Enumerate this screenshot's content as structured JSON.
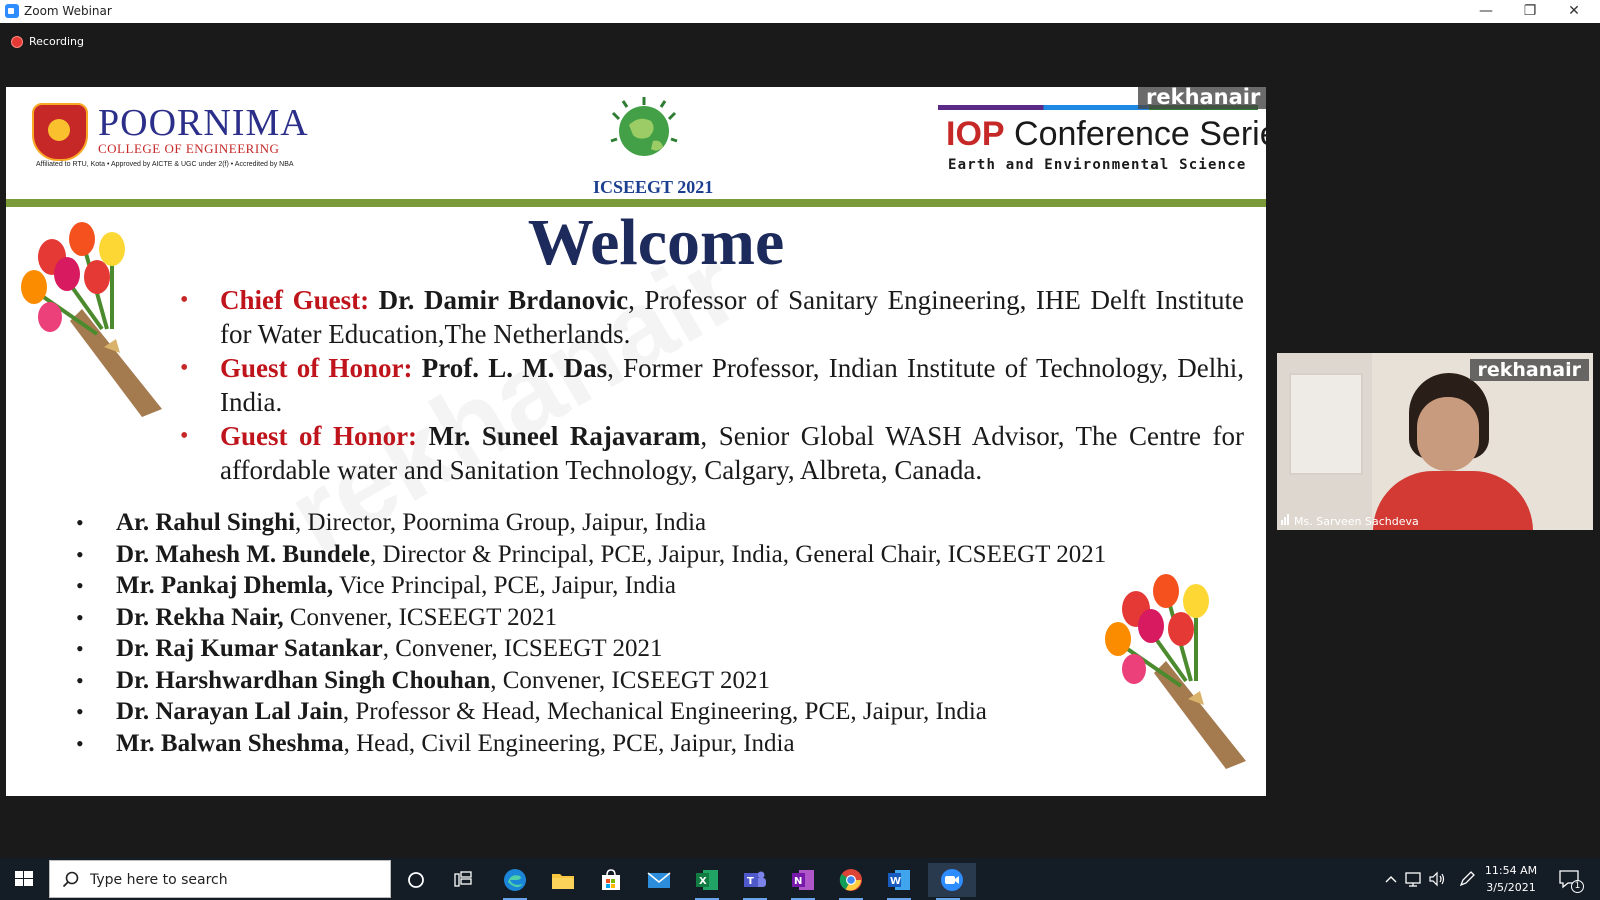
{
  "window": {
    "title": "Zoom Webinar"
  },
  "recording": {
    "label": "Recording"
  },
  "slide": {
    "college_name": "POORNIMA",
    "college_sub": "COLLEGE OF ENGINEERING",
    "college_tag": "Affiliated to RTU, Kota • Approved by AICTE & UGC under 2(f) • Accredited by NBA",
    "conference": "ICSEEGT 2021",
    "iop_brand": "IOP",
    "iop_series": "Conference Series",
    "iop_subtitle": "Earth and Environmental Science",
    "share_name": "rekhanair",
    "welcome": "Welcome",
    "guests": [
      {
        "role": "Chief Guest:",
        "name": "Dr. Damir Brdanovic",
        "desc": ", Professor of Sanitary Engineering, IHE Delft Institute for Water Education,The Netherlands."
      },
      {
        "role": "Guest of Honor:",
        "name": "Prof. L. M. Das",
        "desc": ", Former Professor, Indian Institute of Technology, Delhi, India."
      },
      {
        "role": "Guest of Honor:",
        "name": "Mr. Suneel Rajavaram",
        "desc": ", Senior Global WASH Advisor, The Centre for affordable water and Sanitation Technology, Calgary, Albreta, Canada."
      }
    ],
    "people": [
      {
        "name": "Ar. Rahul Singhi",
        "desc": ", Director, Poornima Group, Jaipur, India"
      },
      {
        "name": "Dr. Mahesh M. Bundele",
        "desc": ", Director & Principal, PCE, Jaipur, India, General Chair, ICSEEGT 2021"
      },
      {
        "name": "Mr. Pankaj Dhemla,",
        "desc": " Vice Principal, PCE, Jaipur, India"
      },
      {
        "name": "Dr. Rekha Nair,",
        "desc": " Convener, ICSEEGT 2021"
      },
      {
        "name": "Dr. Raj Kumar Satankar",
        "desc": ", Convener, ICSEEGT 2021"
      },
      {
        "name": "Dr. Harshwardhan Singh Chouhan",
        "desc": ", Convener, ICSEEGT 2021"
      },
      {
        "name": "Dr. Narayan Lal Jain",
        "desc": ", Professor  & Head, Mechanical Engineering, PCE, Jaipur, India"
      },
      {
        "name": "Mr. Balwan Sheshma",
        "desc": ", Head, Civil Engineering, PCE, Jaipur, India"
      }
    ]
  },
  "video": {
    "name_tag": "rekhanair",
    "participant": "Ms. Sarveen Sachdeva"
  },
  "taskbar": {
    "search_placeholder": "Type here to search",
    "apps": [
      "cortana-icon",
      "task-view-icon",
      "edge-icon",
      "file-explorer-icon",
      "microsoft-store-icon",
      "mail-icon",
      "excel-icon",
      "teams-icon",
      "onenote-icon",
      "chrome-icon",
      "word-icon",
      "zoom-icon"
    ],
    "time": "11:54 AM",
    "date": "3/5/2021",
    "notification_count": "1"
  },
  "colors": {
    "accent_red": "#c0141c",
    "title_blue": "#1d2a5c",
    "rule_green": "#7b9a3a",
    "taskbar": "#141c26"
  }
}
